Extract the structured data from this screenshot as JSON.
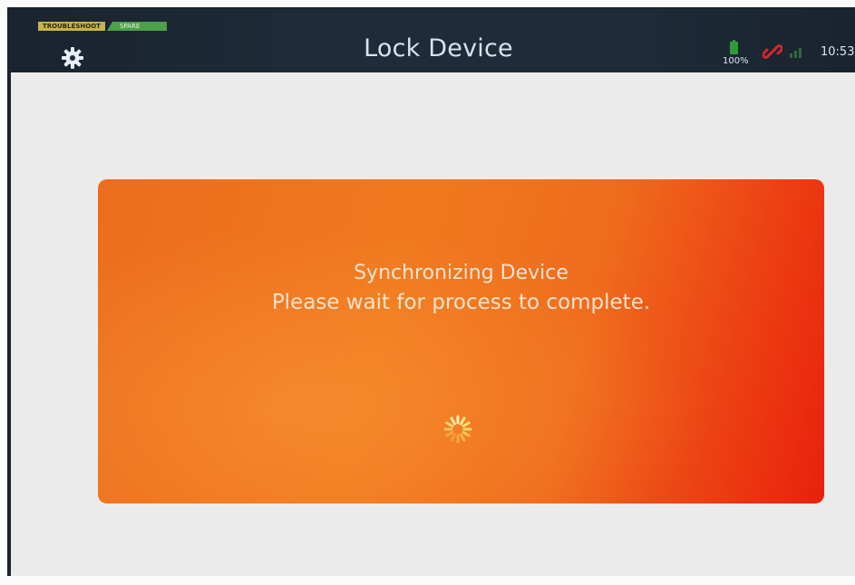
{
  "header": {
    "title": "Lock Device",
    "mode_tag": "TROUBLESHOOT",
    "slot_tag": "SPARE",
    "settings_icon": "gear-icon"
  },
  "status": {
    "battery_percent_label": "100%",
    "battery_level": 1.0,
    "connection_icon": "broken-link-icon",
    "signal_icon": "signal-icon",
    "time": "10:53"
  },
  "dialog": {
    "line1": "Synchronizing Device",
    "line2": "Please wait for process to complete.",
    "spinner_icon": "spinner-icon"
  },
  "colors": {
    "header_bg": "#1f2b39",
    "content_bg": "#ebebeb",
    "card_accent": "#ef6b1c",
    "card_accent_right": "#e8200d",
    "battery_green": "#2f9a3a",
    "link_red": "#d7262b"
  }
}
